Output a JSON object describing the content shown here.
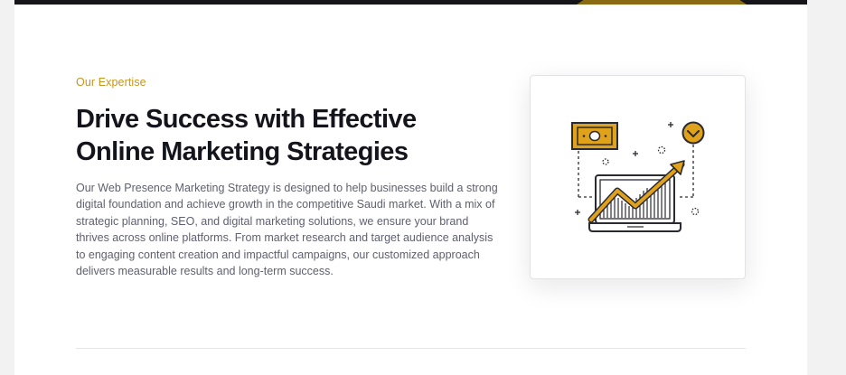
{
  "section": {
    "eyebrow": "Our Expertise",
    "heading": "Drive Success with Effective Online Marketing Strategies",
    "body": "Our Web Presence Marketing Strategy is designed to help businesses build a strong digital foundation and achieve growth in the competitive Saudi market. With a mix of strategic planning, SEO, and digital marketing solutions, we ensure your brand thrives across online platforms. From market research and target audience analysis to engaging content creation and impactful campaigns, our customized approach delivers measurable results and long-term success."
  },
  "illustration": {
    "icon": "marketing-growth-illustration",
    "elements": [
      "money-icon",
      "check-circle-icon",
      "laptop-icon",
      "trend-arrow-icon"
    ]
  },
  "colors": {
    "accent": "#e0a21b",
    "heading": "#14141c",
    "body": "#5f6070",
    "top_bar": "#16161a"
  }
}
